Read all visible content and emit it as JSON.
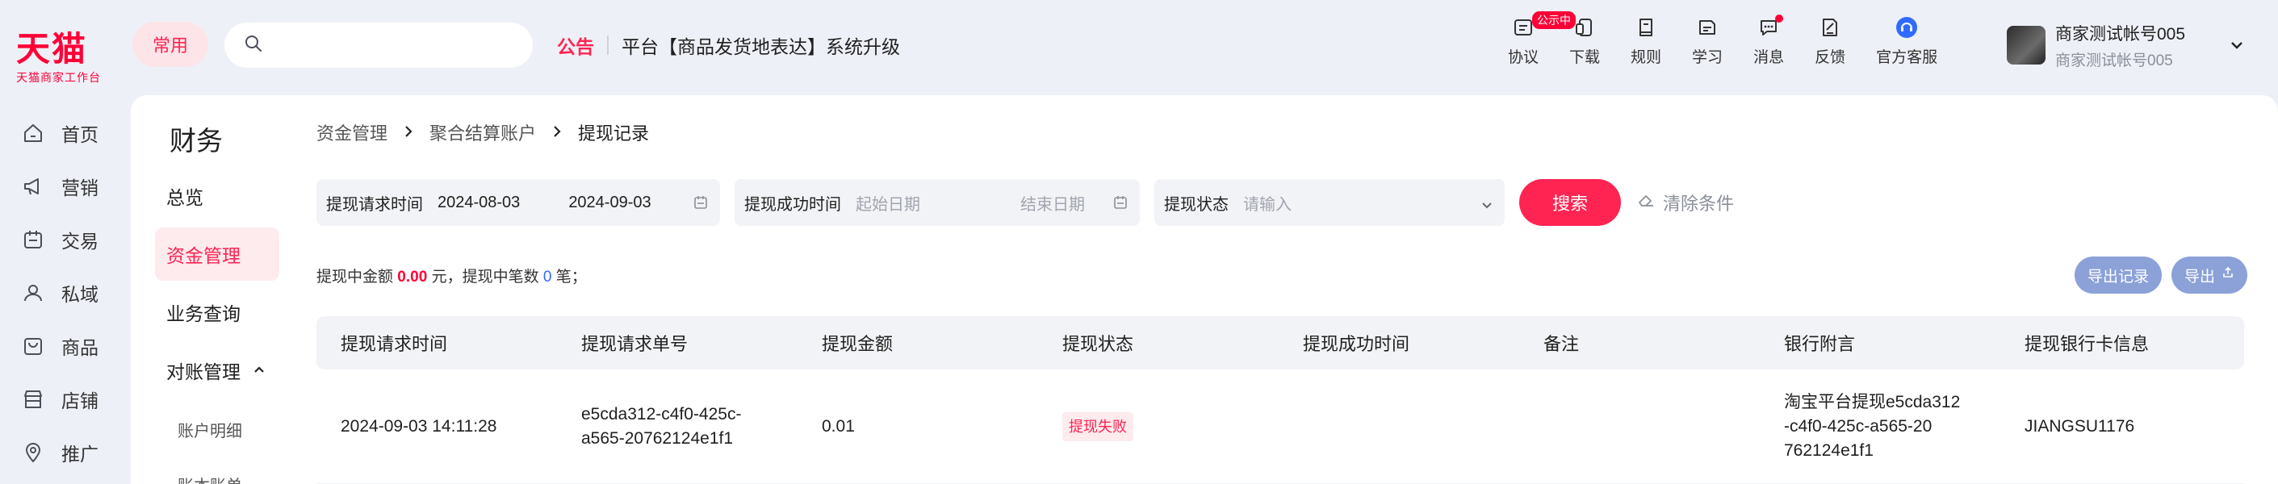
{
  "logo": {
    "main": "天猫",
    "sub": "天猫商家工作台"
  },
  "header": {
    "common_label": "常用",
    "search_placeholder": "",
    "notice_label": "公告",
    "notice_text": "平台【商品发货地表达】系统升级",
    "nav": [
      {
        "label": "协议",
        "icon": "agreement-icon",
        "badge": "公示中"
      },
      {
        "label": "下载",
        "icon": "download-phone-icon"
      },
      {
        "label": "规则",
        "icon": "rules-book-icon"
      },
      {
        "label": "学习",
        "icon": "learn-icon"
      },
      {
        "label": "消息",
        "icon": "message-icon",
        "dot": true
      },
      {
        "label": "反馈",
        "icon": "feedback-icon"
      },
      {
        "label": "官方客服",
        "icon": "customer-service-icon"
      }
    ],
    "user": {
      "name": "商家测试帐号005",
      "sub": "商家测试帐号005"
    }
  },
  "leftnav": [
    {
      "label": "首页",
      "icon": "home-icon"
    },
    {
      "label": "营销",
      "icon": "megaphone-icon"
    },
    {
      "label": "交易",
      "icon": "trade-icon"
    },
    {
      "label": "私域",
      "icon": "private-domain-icon"
    },
    {
      "label": "商品",
      "icon": "goods-icon"
    },
    {
      "label": "店铺",
      "icon": "store-icon"
    },
    {
      "label": "推广",
      "icon": "location-pin-icon"
    }
  ],
  "subnav": {
    "title": "财务",
    "items": [
      {
        "label": "总览"
      },
      {
        "label": "资金管理",
        "active": true
      },
      {
        "label": "业务查询"
      },
      {
        "label": "对账管理",
        "expanded": true
      }
    ],
    "children": [
      "账户明细",
      "账本账单"
    ]
  },
  "breadcrumb": [
    "资金管理",
    "聚合结算账户",
    "提现记录"
  ],
  "filters": {
    "request_time": {
      "label": "提现请求时间",
      "start": "2024-08-03",
      "end": "2024-09-03"
    },
    "success_time": {
      "label": "提现成功时间",
      "start_placeholder": "起始日期",
      "end_placeholder": "结束日期"
    },
    "status": {
      "label": "提现状态",
      "placeholder": "请输入"
    },
    "search_label": "搜索",
    "clear_label": "清除条件"
  },
  "summary": {
    "prefix": "提现中金额",
    "amount": "0.00",
    "middle": "元，提现中笔数",
    "count": "0",
    "suffix": "笔；"
  },
  "exports": {
    "records_label": "导出记录",
    "export_label": "导出"
  },
  "table": {
    "columns": [
      "提现请求时间",
      "提现请求单号",
      "提现金额",
      "提现状态",
      "提现成功时间",
      "备注",
      "银行附言",
      "提现银行卡信息"
    ],
    "rows": [
      {
        "request_time": "2024-09-03 14:11:28",
        "order_no_line1": "e5cda312-c4f0-425c-",
        "order_no_line2": "a565-20762124e1f1",
        "amount": "0.01",
        "status": "提现失败",
        "success_time": "",
        "remark": "",
        "bank_note_line1": "淘宝平台提现e5cda312",
        "bank_note_line2": "-c4f0-425c-a565-20",
        "bank_note_line3": "762124e1f1",
        "bank_card": "JIANGSU1176"
      }
    ]
  },
  "colors": {
    "brand": "#ff0036",
    "accent": "#ff2452",
    "export_button": "#8ba1d8",
    "count_blue": "#2f6bff"
  }
}
